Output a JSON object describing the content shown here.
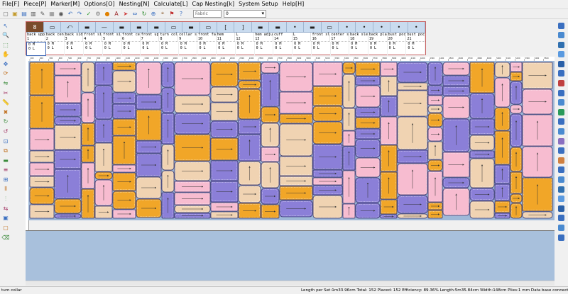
{
  "menu": [
    "File[F]",
    "Piece[P]",
    "Marker[M]",
    "Options[O]",
    "Nesting[N]",
    "Calculate[L]",
    "Cap Nesting[k]",
    "System Setup",
    "Help[H]"
  ],
  "toolbar": {
    "icons": [
      "new-icon",
      "open-icon",
      "save-icon",
      "print-icon",
      "plot-icon",
      "grid-icon",
      "camera-icon",
      "undo-icon",
      "redo-icon",
      "check-icon",
      "gear-icon",
      "color-icon",
      "text-icon",
      "arrow-icon",
      "compress-icon",
      "rotate-icon",
      "zoom-icon",
      "measure-icon",
      "flag-icon",
      "help-icon"
    ],
    "fabric_placeholder": "Fabric",
    "number_value": "0"
  },
  "pieces": {
    "top_glyphs": [
      "8",
      "▭",
      "⤺",
      "▬",
      "—",
      "▬",
      "▬",
      "▬",
      "▭",
      "▬",
      "▭",
      "[",
      "]",
      "▬",
      "▬",
      "•",
      "▬",
      "▭",
      "•",
      "•",
      "•",
      "•",
      "•"
    ],
    "names": [
      "back upper",
      "back center",
      "back sidel",
      "front sidel",
      "front side",
      "front center",
      "front upper",
      "turn collar",
      "collar stand",
      "front facing",
      "hem",
      "L",
      "hem adjuster",
      "cuff",
      "L",
      "front sleeve",
      "center sleeve",
      "back sleeve",
      "back placket",
      "bust pocket",
      "bust pocket"
    ],
    "numbers": [
      "1",
      "2",
      "3",
      "4",
      "5",
      "6",
      "7",
      "8",
      "9",
      "10",
      "11",
      "12",
      "13",
      "14",
      "15",
      "16",
      "17",
      "18",
      "19",
      "20",
      "21"
    ],
    "qty_line1": "0 M",
    "qty_line2": "0 L"
  },
  "ruler_labels": [
    "100",
    "200",
    "300",
    "400",
    "500",
    "600",
    "700",
    "800",
    "900",
    "1000",
    "1100",
    "1200",
    "1300",
    "1400",
    "1500",
    "1600",
    "1700",
    "1800",
    "1900",
    "2000",
    "2100",
    "2200",
    "2300",
    "2400",
    "2500",
    "2600",
    "2700",
    "2800",
    "2900",
    "3000",
    "3100",
    "3200",
    "3300",
    "3400",
    "3500",
    "3600",
    "3700",
    "3800",
    "3900",
    "4000",
    "4100",
    "4200",
    "4300",
    "4400",
    "4500",
    "4600",
    "4700",
    "4800",
    "4900",
    "5000",
    "5100",
    "5200",
    "5300",
    "5400",
    "5500"
  ],
  "colors": {
    "orange": "#f1a628",
    "purple": "#8b7fd8",
    "pink": "#f7bcd0",
    "tan": "#f0d3b2",
    "outline": "#3a3a70",
    "marker_bg": "#9fb8d8"
  },
  "status": {
    "current_piece": "turn collar",
    "details": "Length per Set:1m33.96cm  Total: 152  Placed: 152  Efficiency: 89.36%  Length:5m35.84cm  Width:148cm  Plies:1  mm      Data base connection successful"
  }
}
